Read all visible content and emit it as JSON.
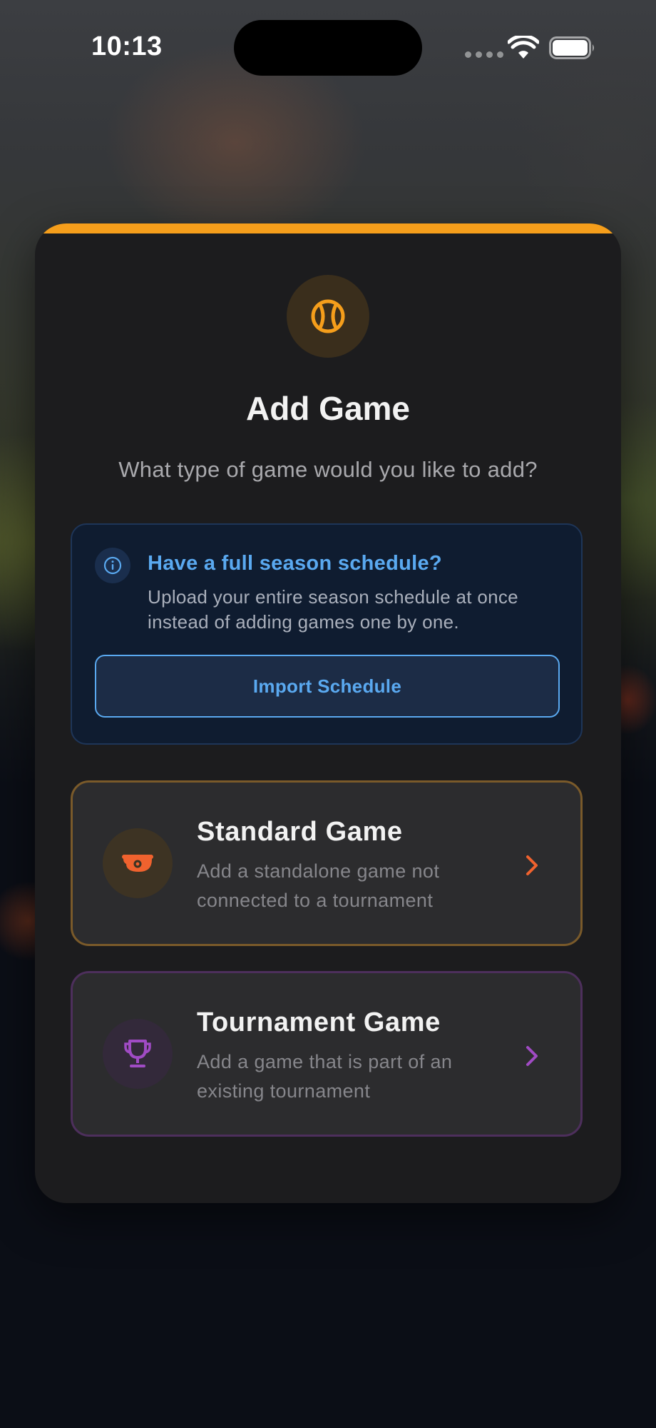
{
  "status_bar": {
    "time": "10:13"
  },
  "modal": {
    "accent_color": "#f59e1b",
    "header_icon": "baseball-icon",
    "title": "Add Game",
    "subtitle": "What type of game would you like to add?",
    "info_box": {
      "icon": "info-icon",
      "title": "Have a full season schedule?",
      "text": "Upload your entire season schedule at once instead of adding games one by one.",
      "button_label": "Import Schedule",
      "color": "#5aa9f0"
    },
    "options": [
      {
        "icon": "whistle-icon",
        "title": "Standard Game",
        "description": "Add a standalone game not connected to a tournament",
        "color": "#f0622e"
      },
      {
        "icon": "trophy-icon",
        "title": "Tournament Game",
        "description": "Add a game that is part of an existing tournament",
        "color": "#a04bc4"
      }
    ]
  }
}
